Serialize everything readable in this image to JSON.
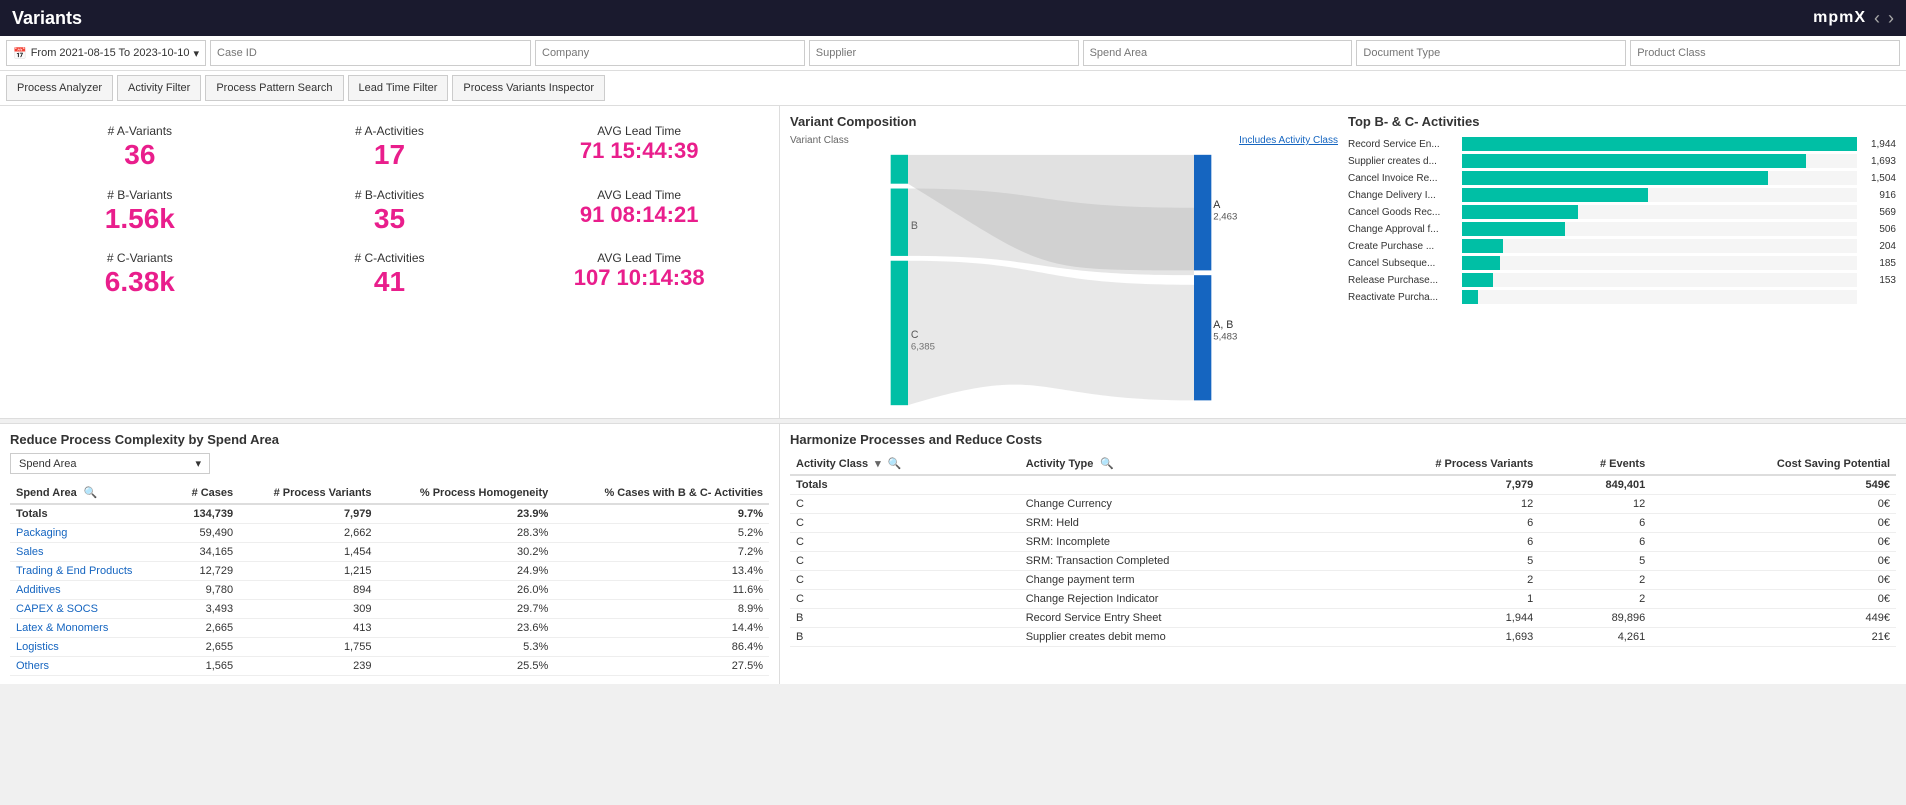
{
  "topbar": {
    "title": "Variants",
    "logo": "mpmX",
    "nav_prev": "‹",
    "nav_next": "›"
  },
  "filters_row1": {
    "date_range": "From 2021-08-15 To 2023-10-10",
    "case_id": "Case ID",
    "company": "Company",
    "supplier": "Supplier",
    "spend_area": "Spend Area",
    "document_type": "Document Type",
    "product_class": "Product Class"
  },
  "filters_row2": {
    "process_analyzer": "Process Analyzer",
    "activity_filter": "Activity Filter",
    "process_pattern_search": "Process Pattern Search",
    "lead_time_filter": "Lead Time Filter",
    "process_variants_inspector": "Process Variants Inspector"
  },
  "kpis": {
    "a_variants_label": "# A-Variants",
    "a_variants_value": "36",
    "b_variants_label": "# B-Variants",
    "b_variants_value": "1.56k",
    "c_variants_label": "# C-Variants",
    "c_variants_value": "6.38k",
    "a_activities_label": "# A-Activities",
    "a_activities_value": "17",
    "b_activities_label": "# B-Activities",
    "b_activities_value": "35",
    "c_activities_label": "# C-Activities",
    "c_activities_value": "41",
    "avg_lead_a_label": "AVG Lead Time",
    "avg_lead_a_value": "71 15:44:39",
    "avg_lead_b_label": "AVG Lead Time",
    "avg_lead_b_value": "91 08:14:21",
    "avg_lead_c_label": "AVG Lead Time",
    "avg_lead_c_value": "107 10:14:38"
  },
  "variant_composition": {
    "title": "Variant Composition",
    "variant_class_label": "Variant Class",
    "includes_activity_class": "Includes Activity Class",
    "b_label": "B",
    "b_value": "",
    "c_label": "C",
    "c_value": "6,385",
    "a_value": "2,463",
    "ab_value": "5,483",
    "a_right": "A",
    "ab_right": "A, B"
  },
  "top_activities": {
    "title": "Top B- & C- Activities",
    "bars": [
      {
        "label": "Record Service En...",
        "value": 1944,
        "display": "1,944",
        "max": 1944
      },
      {
        "label": "Supplier creates d...",
        "value": 1693,
        "display": "1,693",
        "max": 1944
      },
      {
        "label": "Cancel Invoice Re...",
        "value": 1504,
        "display": "1,504",
        "max": 1944
      },
      {
        "label": "Change Delivery I...",
        "value": 916,
        "display": "916",
        "max": 1944
      },
      {
        "label": "Cancel Goods Rec...",
        "value": 569,
        "display": "569",
        "max": 1944
      },
      {
        "label": "Change Approval f...",
        "value": 506,
        "display": "506",
        "max": 1944
      },
      {
        "label": "Create Purchase ...",
        "value": 204,
        "display": "204",
        "max": 1944
      },
      {
        "label": "Cancel Subseque...",
        "value": 185,
        "display": "185",
        "max": 1944
      },
      {
        "label": "Release Purchase...",
        "value": 153,
        "display": "153",
        "max": 1944
      },
      {
        "label": "Reactivate Purcha...",
        "value": 80,
        "display": "",
        "max": 1944
      }
    ]
  },
  "spend_area_section": {
    "title": "Reduce Process Complexity by Spend Area",
    "dropdown_label": "Spend Area",
    "columns": [
      "Spend Area",
      "# Cases",
      "# Process Variants",
      "% Process Homogeneity",
      "% Cases with B & C- Activities"
    ],
    "totals": {
      "spend_area": "Totals",
      "cases": "134,739",
      "process_variants": "7,979",
      "homogeneity": "23.9%",
      "bc_cases": "9.7%"
    },
    "rows": [
      {
        "name": "Packaging",
        "cases": "59,490",
        "variants": "2,662",
        "homogeneity": "28.3%",
        "bc": "5.2%",
        "bc_high": false
      },
      {
        "name": "Sales",
        "cases": "34,165",
        "variants": "1,454",
        "homogeneity": "30.2%",
        "bc": "7.2%",
        "bc_high": false
      },
      {
        "name": "Trading & End Products",
        "cases": "12,729",
        "variants": "1,215",
        "homogeneity": "24.9%",
        "bc": "13.4%",
        "bc_high": true
      },
      {
        "name": "Additives",
        "cases": "9,780",
        "variants": "894",
        "homogeneity": "26.0%",
        "bc": "11.6%",
        "bc_high": true
      },
      {
        "name": "CAPEX & SOCS",
        "cases": "3,493",
        "variants": "309",
        "homogeneity": "29.7%",
        "bc": "8.9%",
        "bc_high": false
      },
      {
        "name": "Latex & Monomers",
        "cases": "2,665",
        "variants": "413",
        "homogeneity": "23.6%",
        "bc": "14.4%",
        "bc_high": true
      },
      {
        "name": "Logistics",
        "cases": "2,655",
        "variants": "1,755",
        "homogeneity": "5.3%",
        "bc": "86.4%",
        "bc_high": true
      },
      {
        "name": "Others",
        "cases": "1,565",
        "variants": "239",
        "homogeneity": "25.5%",
        "bc": "27.5%",
        "bc_high": true
      }
    ]
  },
  "harmonize_section": {
    "title": "Harmonize Processes and Reduce Costs",
    "columns": [
      "Activity Class",
      "Activity Type",
      "# Process Variants",
      "# Events",
      "Cost Saving Potential"
    ],
    "totals": {
      "activity_class": "Totals",
      "activity_type": "",
      "process_variants": "7,979",
      "events": "849,401",
      "cost_saving": "549€"
    },
    "rows": [
      {
        "class": "C",
        "type": "Change Currency",
        "variants": "12",
        "events": "12",
        "cost": "0€"
      },
      {
        "class": "C",
        "type": "SRM: Held",
        "variants": "6",
        "events": "6",
        "cost": "0€"
      },
      {
        "class": "C",
        "type": "SRM: Incomplete",
        "variants": "6",
        "events": "6",
        "cost": "0€"
      },
      {
        "class": "C",
        "type": "SRM: Transaction Completed",
        "variants": "5",
        "events": "5",
        "cost": "0€"
      },
      {
        "class": "C",
        "type": "Change payment term",
        "variants": "2",
        "events": "2",
        "cost": "0€"
      },
      {
        "class": "C",
        "type": "Change Rejection Indicator",
        "variants": "1",
        "events": "2",
        "cost": "0€"
      },
      {
        "class": "B",
        "type": "Record Service Entry Sheet",
        "variants": "1,944",
        "events": "89,896",
        "cost": "449€"
      },
      {
        "class": "B",
        "type": "Supplier creates debit memo",
        "variants": "1,693",
        "events": "4,261",
        "cost": "21€"
      }
    ]
  }
}
